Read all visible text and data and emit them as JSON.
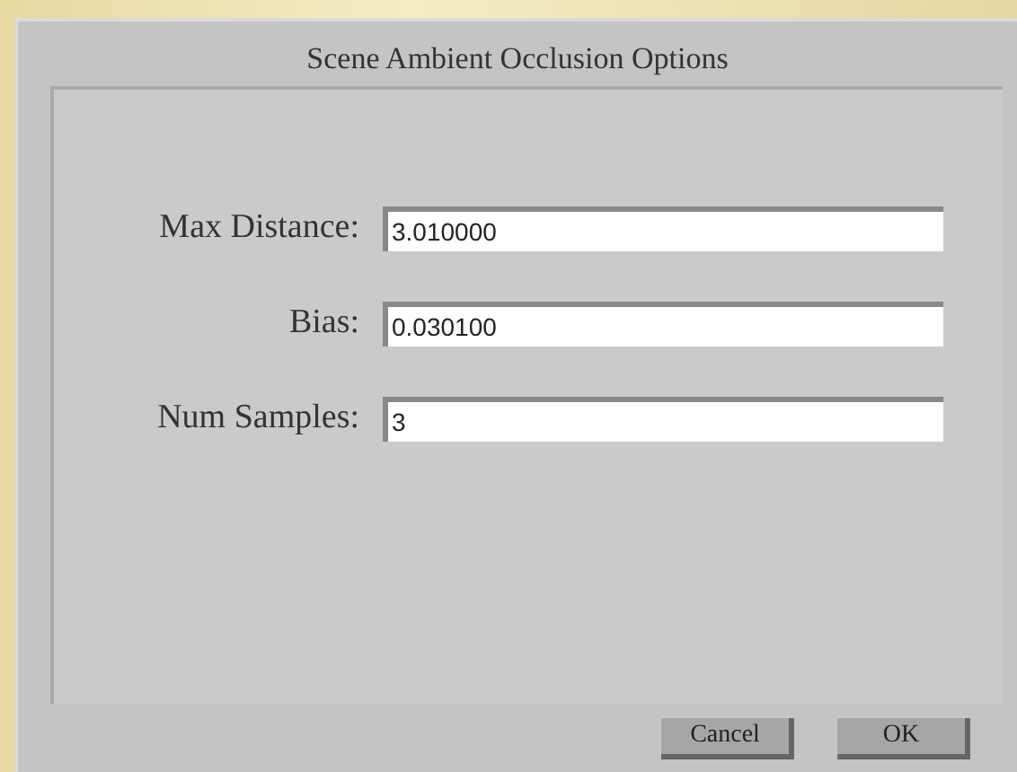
{
  "window": {
    "title": "Scene Ambient Occlusion Options"
  },
  "fields": [
    {
      "label": "Max Distance:",
      "value": "3.010000"
    },
    {
      "label": "Bias:",
      "value": "0.030100"
    },
    {
      "label": "Num Samples:",
      "value": "3"
    }
  ],
  "buttons": [
    {
      "label": "Cancel"
    },
    {
      "label": "OK"
    }
  ]
}
